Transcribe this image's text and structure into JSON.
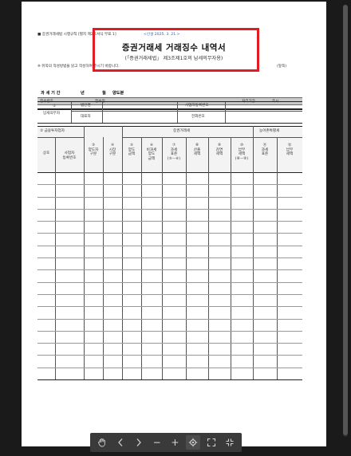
{
  "header": {
    "form_note": "■ 증권거래세법 시행규칙 [별지 제2호서식 부표 1]",
    "revision": "<신설 2025. 3. 21.>",
    "title": "증권거래세 거래징수 내역서",
    "subtitle": "(「증권거래세법」 제3조제1호의 납세의무자용)",
    "instruction": "※ 뒤쪽의 작성방법을 읽고 작성하여 주시기 바랍니다.",
    "page_side": "(앞쪽)"
  },
  "receipt_row": {
    "receipt_no": "접수번호",
    "receipt_date": "접수일",
    "processing_period": "처리기간",
    "immediate": "즉시"
  },
  "period": {
    "label": "과 세 기 간",
    "year": "년",
    "month": "월",
    "half": "양도분"
  },
  "taxpayer": {
    "section_no": "①",
    "section_label": "납세의무자",
    "corp_name": "법인명",
    "biz_reg_no": "사업자등록번호",
    "representative": "대표자",
    "phone": "전화번호"
  },
  "table": {
    "group_financial": "② 금융투자업자",
    "group_securities_tax": "증권거래세",
    "group_rural_tax": "농어촌특별세",
    "col_name": "상호",
    "col_brn": "사업자\n등록번호",
    "col_transferor": "③\n양도자\n구분",
    "col_market": "④\n시장\n구분",
    "col_amount": "⑤\n양도\n금액",
    "col_nontax": "⑥\n비과세\n양도\n금액",
    "col_taxbase": "⑦\n과세\n표준\n(⑤－⑥)",
    "col_calc_tax": "⑧\n산출\n세액",
    "col_reduced": "⑨\n감면\n세액",
    "col_payable": "⑩\n납부\n세액\n(⑧－⑨)",
    "col_rural_base": "⑪\n과세\n표준",
    "col_rural_tax": "⑫\n납부\n세액",
    "empty_rows": 17
  },
  "toolbar": {
    "hand_icon": "hand-icon",
    "prev_icon": "chevron-left-icon",
    "next_icon": "chevron-right-icon",
    "zoom_out": "−",
    "zoom_in": "+",
    "fit_icon": "fit-page-icon",
    "fullscreen_icon": "fullscreen-icon",
    "exit_icon": "collapse-icon"
  },
  "colors": {
    "highlight_border": "#e31b23",
    "revision_text": "#2b55c9",
    "header_gray": "#c9c9c9"
  }
}
